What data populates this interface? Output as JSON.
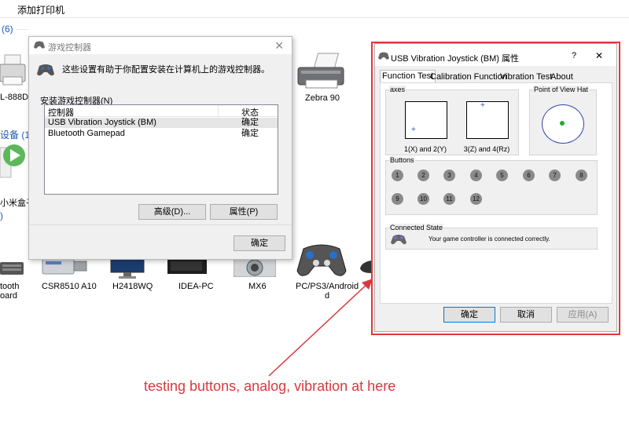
{
  "explorer": {
    "toolbar_action": "添加打印机",
    "printers_count": "(6)",
    "devices_header": "设备 (1)",
    "other_count": ")",
    "printer_left_label": "L-888D",
    "printer_right_label": "Zebra 90",
    "media_label": "小米盒子",
    "devices": [
      {
        "label": "tooth\noard",
        "icon": "keyboard-icon"
      },
      {
        "label": "CSR8510 A10",
        "icon": "usb-dongle-icon"
      },
      {
        "label": "H2418WQ",
        "icon": "monitor-icon"
      },
      {
        "label": "IDEA-PC",
        "icon": "computer-icon"
      },
      {
        "label": "MX6",
        "icon": "camera-icon"
      },
      {
        "label": "PC/PS3/Android",
        "icon": "gamepad-icon"
      }
    ],
    "device_sublabel": "d"
  },
  "controllers_dialog": {
    "title": "游戏控制器",
    "description": "这些设置有助于你配置安装在计算机上的游戏控制器。",
    "list_label": "安装游戏控制器(N)",
    "col_controller": "控制器",
    "col_status": "状态",
    "rows": [
      {
        "name": "USB Vibration Joystick (BM)",
        "status": "确定"
      },
      {
        "name": "Bluetooth Gamepad",
        "status": "确定"
      }
    ],
    "advanced_button": "高级(D)...",
    "properties_button": "属性(P)",
    "ok_button": "确定"
  },
  "properties_dialog": {
    "title": "USB Vibration Joystick (BM) 属性",
    "help": "?",
    "close": "✕",
    "tabs": [
      "Function Test",
      "Calibration Function",
      "Vibration Test",
      "About"
    ],
    "active_tab": "Function Test",
    "axes_label": "axes",
    "axis1_caption": "1(X) and 2(Y)",
    "axis2_caption": "3(Z) and 4(Rz)",
    "pov_label": "Point of View Hat",
    "buttons_label": "Buttons",
    "buttons": [
      "1",
      "2",
      "3",
      "4",
      "5",
      "6",
      "7",
      "8",
      "9",
      "10",
      "11",
      "12"
    ],
    "connected_label": "Connected State",
    "connected_text": "Your game controller is connected correctly.",
    "ok_button": "确定",
    "cancel_button": "取消",
    "apply_button": "应用(A)"
  },
  "annotation": "testing buttons, analog, vibration at here",
  "colors": {
    "highlight": "#e0353b",
    "annotation": "#d9393d",
    "pov_dot": "#22aa33"
  }
}
